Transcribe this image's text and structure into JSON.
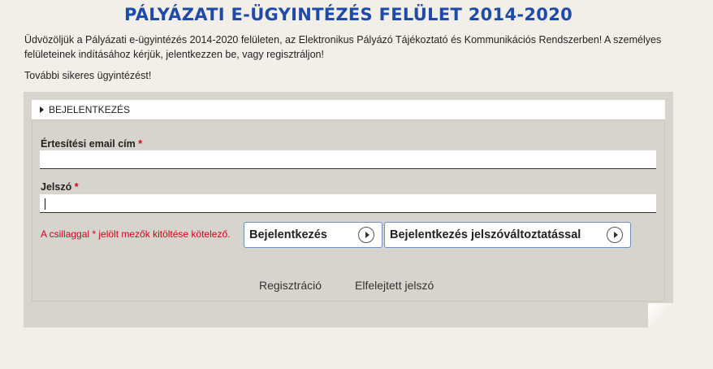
{
  "header": {
    "title": "PÁLYÁZATI E-ÜGYINTÉZÉS FELÜLET 2014-2020",
    "intro": "Üdvözöljük a Pályázati e-ügyintézés 2014-2020 felületen, az Elektronikus Pályázó Tájékoztató és Kommunikációs Rendszerben! A személyes felületeinek indításához kérjük, jelentkezzen be, vagy regisztráljon!",
    "closing": "További sikeres ügyintézést!"
  },
  "login": {
    "section_title": "BEJELENTKEZÉS",
    "email_label": "Értesítési email cím",
    "email_value": "",
    "password_label": "Jelszó",
    "password_value": "",
    "required_marker": "*",
    "required_note": "A csillaggal * jelölt mezők kitöltése kötelező.",
    "login_button": "Bejelentkezés",
    "login_change_password_button": "Bejelentkezés jelszóváltoztatással",
    "register_link": "Regisztráció",
    "forgot_password_link": "Elfelejtett jelszó"
  },
  "icons": {
    "section_toggle": "caret-right-icon",
    "button_arrow": "circle-arrow-right-icon"
  },
  "colors": {
    "title": "#1f4aa8",
    "required": "#d0021b",
    "panel": "#d6d4cc",
    "page_background": "#f2efe8",
    "button_border": "#6e8fc0"
  }
}
